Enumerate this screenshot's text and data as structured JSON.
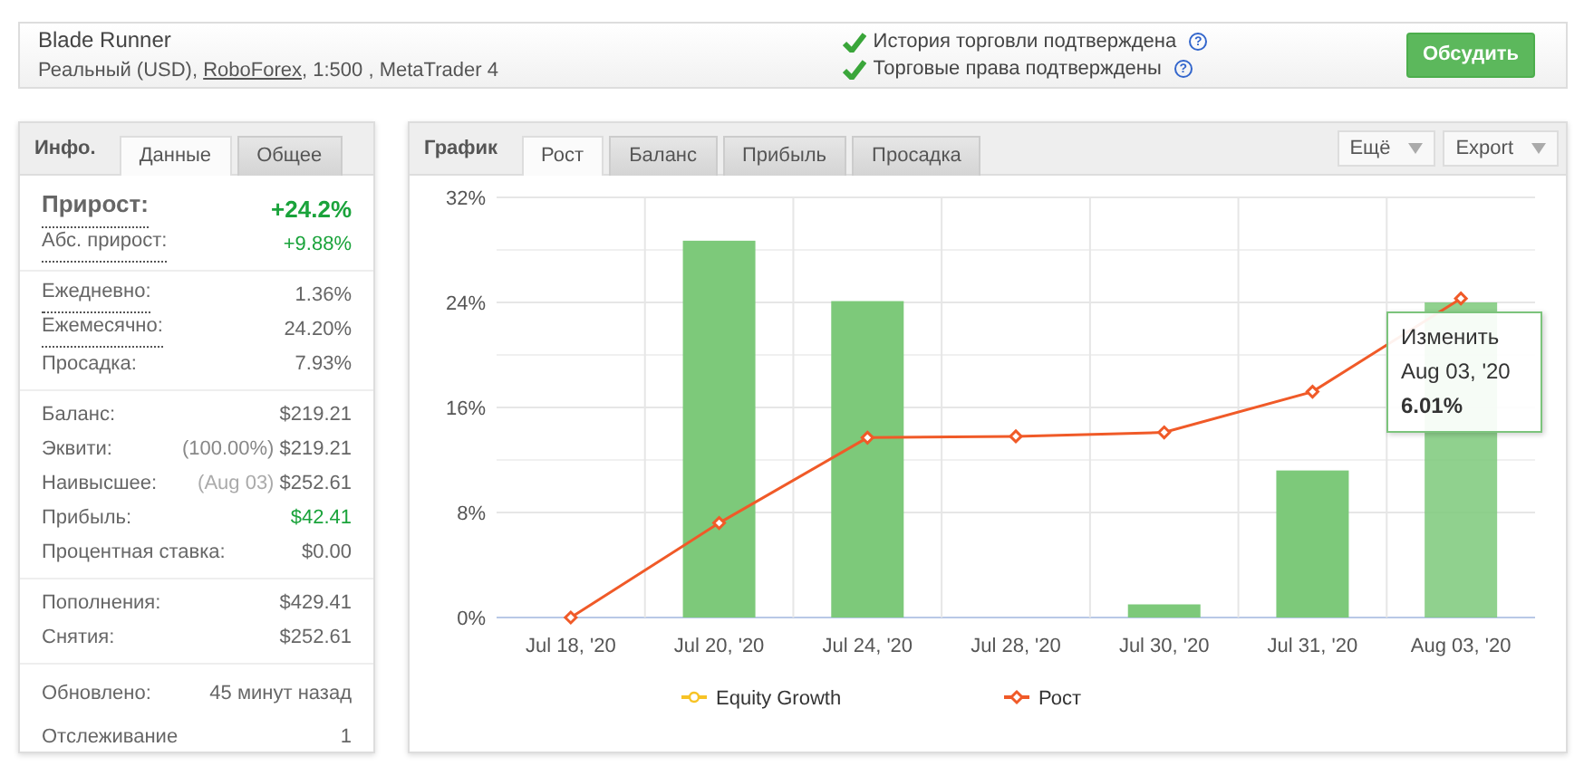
{
  "header": {
    "title": "Blade Runner",
    "subtitle_parts": [
      "Реальный (USD), ",
      "RoboForex",
      ", 1:500 , MetaTrader 4"
    ],
    "verifications": [
      {
        "text": "История торговли подтверждена",
        "checked": true,
        "help": "?"
      },
      {
        "text": "Торговые права подтверждены",
        "checked": true,
        "help": "?"
      }
    ],
    "button": "Обсудить"
  },
  "info": {
    "title": "Инфо.",
    "tabs": [
      {
        "label": "Данные",
        "selected": true
      },
      {
        "label": "Общее",
        "selected": false
      }
    ],
    "sections": [
      [
        {
          "label": "Прирост:",
          "value": "+24.2%",
          "kind": "big",
          "underlined": true,
          "positive": true
        },
        {
          "label": "Абс. прирост:",
          "value": "+9.88%",
          "kind": "normal",
          "underlined": true,
          "positive": true
        }
      ],
      [
        {
          "label": "Ежедневно:",
          "value": "1.36%",
          "kind": "normal",
          "underlined": true,
          "positive": false
        },
        {
          "label": "Ежемесячно:",
          "value": "24.20%",
          "kind": "normal",
          "underlined": true,
          "positive": false
        },
        {
          "label": "Просадка:",
          "value": "7.93%",
          "kind": "normal",
          "underlined": false,
          "positive": false
        }
      ],
      [
        {
          "label": "Баланс:",
          "value": "$219.21",
          "kind": "normal",
          "underlined": false,
          "positive": false
        },
        {
          "label": "Эквити:",
          "note": "(100.00%)",
          "value": "$219.21",
          "kind": "normal",
          "underlined": false,
          "positive": false
        },
        {
          "label": "Наивысшее:",
          "note": "(Aug 03)",
          "value": "$252.61",
          "kind": "normal",
          "underlined": false,
          "positive": false
        },
        {
          "label": "Прибыль:",
          "value": "$42.41",
          "kind": "normal",
          "underlined": false,
          "positive": true
        },
        {
          "label": "Процентная ставка:",
          "value": "$0.00",
          "kind": "normal",
          "underlined": false,
          "positive": false
        }
      ],
      [
        {
          "label": "Пополнения:",
          "value": "$429.41",
          "kind": "normal",
          "underlined": false,
          "positive": false
        },
        {
          "label": "Снятия:",
          "value": "$252.61",
          "kind": "normal",
          "underlined": false,
          "positive": false
        }
      ],
      [
        {
          "label": "Обновлено:",
          "value": "45 минут назад",
          "kind": "tall",
          "underlined": false,
          "positive": false
        },
        {
          "label": "Отслеживание",
          "value": "1",
          "kind": "tall",
          "underlined": false,
          "positive": false
        }
      ]
    ]
  },
  "chart_panel": {
    "title": "График",
    "tabs": [
      {
        "label": "Рост",
        "selected": true
      },
      {
        "label": "Баланс",
        "selected": false
      },
      {
        "label": "Прибыль",
        "selected": false
      },
      {
        "label": "Просадка",
        "selected": false
      }
    ],
    "menus": [
      "Ещё",
      "Export"
    ],
    "chart_data": {
      "type": "bar",
      "categories": [
        "Jul 18, '20",
        "Jul 20, '20",
        "Jul 24, '20",
        "Jul 28, '20",
        "Jul 30, '20",
        "Jul 31, '20",
        "Aug 03, '20"
      ],
      "yticks": [
        {
          "value": 0,
          "label": "0%"
        },
        {
          "value": 8,
          "label": "8%"
        },
        {
          "value": 16,
          "label": "16%"
        },
        {
          "value": 24,
          "label": "24%"
        },
        {
          "value": 32,
          "label": "32%"
        }
      ],
      "ylim": [
        0,
        32
      ],
      "grid": true,
      "series": [
        {
          "color": "#7dc97a",
          "values": [
            0,
            28.7,
            24.1,
            0,
            1.0,
            11.2,
            24.0
          ]
        },
        {
          "name": "Equity Growth",
          "type": "line",
          "color": "#f7c325",
          "marker": "circle",
          "values": [
            null,
            null,
            null,
            null,
            null,
            null,
            null
          ]
        },
        {
          "name": "Рост",
          "type": "line",
          "color": "#f05a28",
          "marker": "diamond",
          "values": [
            0,
            7.2,
            13.7,
            13.8,
            14.1,
            17.2,
            24.3
          ]
        }
      ]
    },
    "tooltip": {
      "label": "Изменить",
      "date": "Aug 03, '20",
      "value": "6.01%"
    }
  }
}
